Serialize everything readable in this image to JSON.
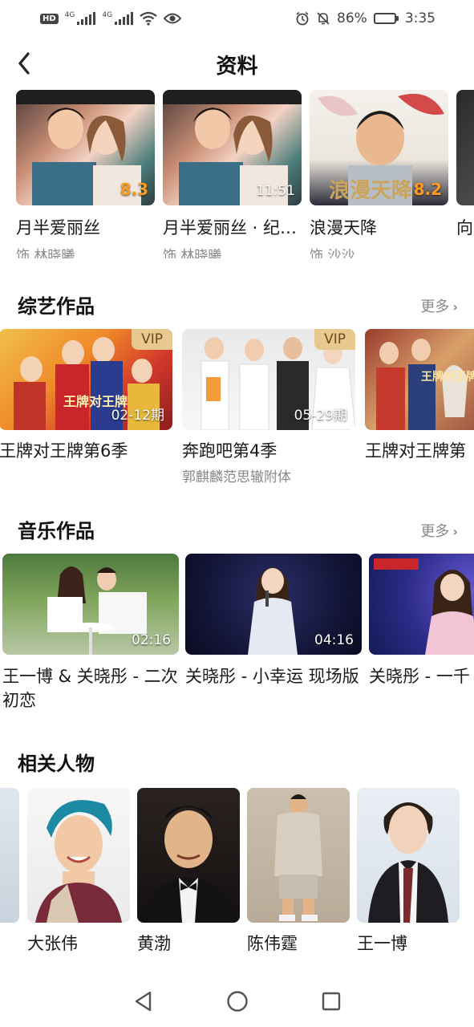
{
  "status_bar": {
    "hd_label": "HD",
    "net1": "4G",
    "net2": "4G",
    "battery_pct": "86%",
    "time": "3:35",
    "battery_level": 0.86,
    "icons": [
      "hd-icon",
      "signal-icon",
      "wifi-icon",
      "eye-icon",
      "alarm-icon",
      "mute-icon",
      "battery-icon"
    ]
  },
  "header": {
    "title": "资料",
    "back_icon": "chevron-left-icon"
  },
  "roles": [
    {
      "title": "月半爱丽丝",
      "sub": "饰 林晓曦",
      "overlay": "8.3",
      "overlay_type": "score"
    },
    {
      "title": "月半爱丽丝 · 纪录片",
      "sub": "饰 林晓曦",
      "overlay": "11:51",
      "overlay_type": "time"
    },
    {
      "title": "浪漫天降",
      "sub": "饰 沙沙",
      "overlay": "8.2",
      "overlay_type": "score"
    },
    {
      "title": "向",
      "sub": "",
      "overlay": "",
      "overlay_type": ""
    }
  ],
  "variety": {
    "title": "综艺作品",
    "more": "更多",
    "items": [
      {
        "title": "王牌对王牌第6季",
        "sub": "",
        "vip": "VIP",
        "time": "02-12期"
      },
      {
        "title": "奔跑吧第4季",
        "sub": "郭麒麟范思辙附体",
        "vip": "VIP",
        "time": "05-29期"
      },
      {
        "title": "王牌对王牌第",
        "sub": "",
        "vip": "",
        "time": ""
      }
    ]
  },
  "music": {
    "title": "音乐作品",
    "more": "更多",
    "items": [
      {
        "title": "王一博 & 关晓彤 - 二次初恋",
        "time": "02:16"
      },
      {
        "title": "关晓彤 - 小幸运 现场版",
        "time": "04:16"
      },
      {
        "title": "关晓彤 - 一千",
        "time": ""
      }
    ]
  },
  "people": {
    "title": "相关人物",
    "items": [
      {
        "name": "大张伟"
      },
      {
        "name": "黄渤"
      },
      {
        "name": "陈伟霆"
      },
      {
        "name": "王一博"
      }
    ]
  },
  "nav": {
    "icons": [
      "back-triangle-icon",
      "home-circle-icon",
      "recents-square-icon"
    ]
  },
  "colors": {
    "score": "#ff9a1f",
    "vip_bg": "#e9c88f",
    "muted_text": "#888888"
  }
}
